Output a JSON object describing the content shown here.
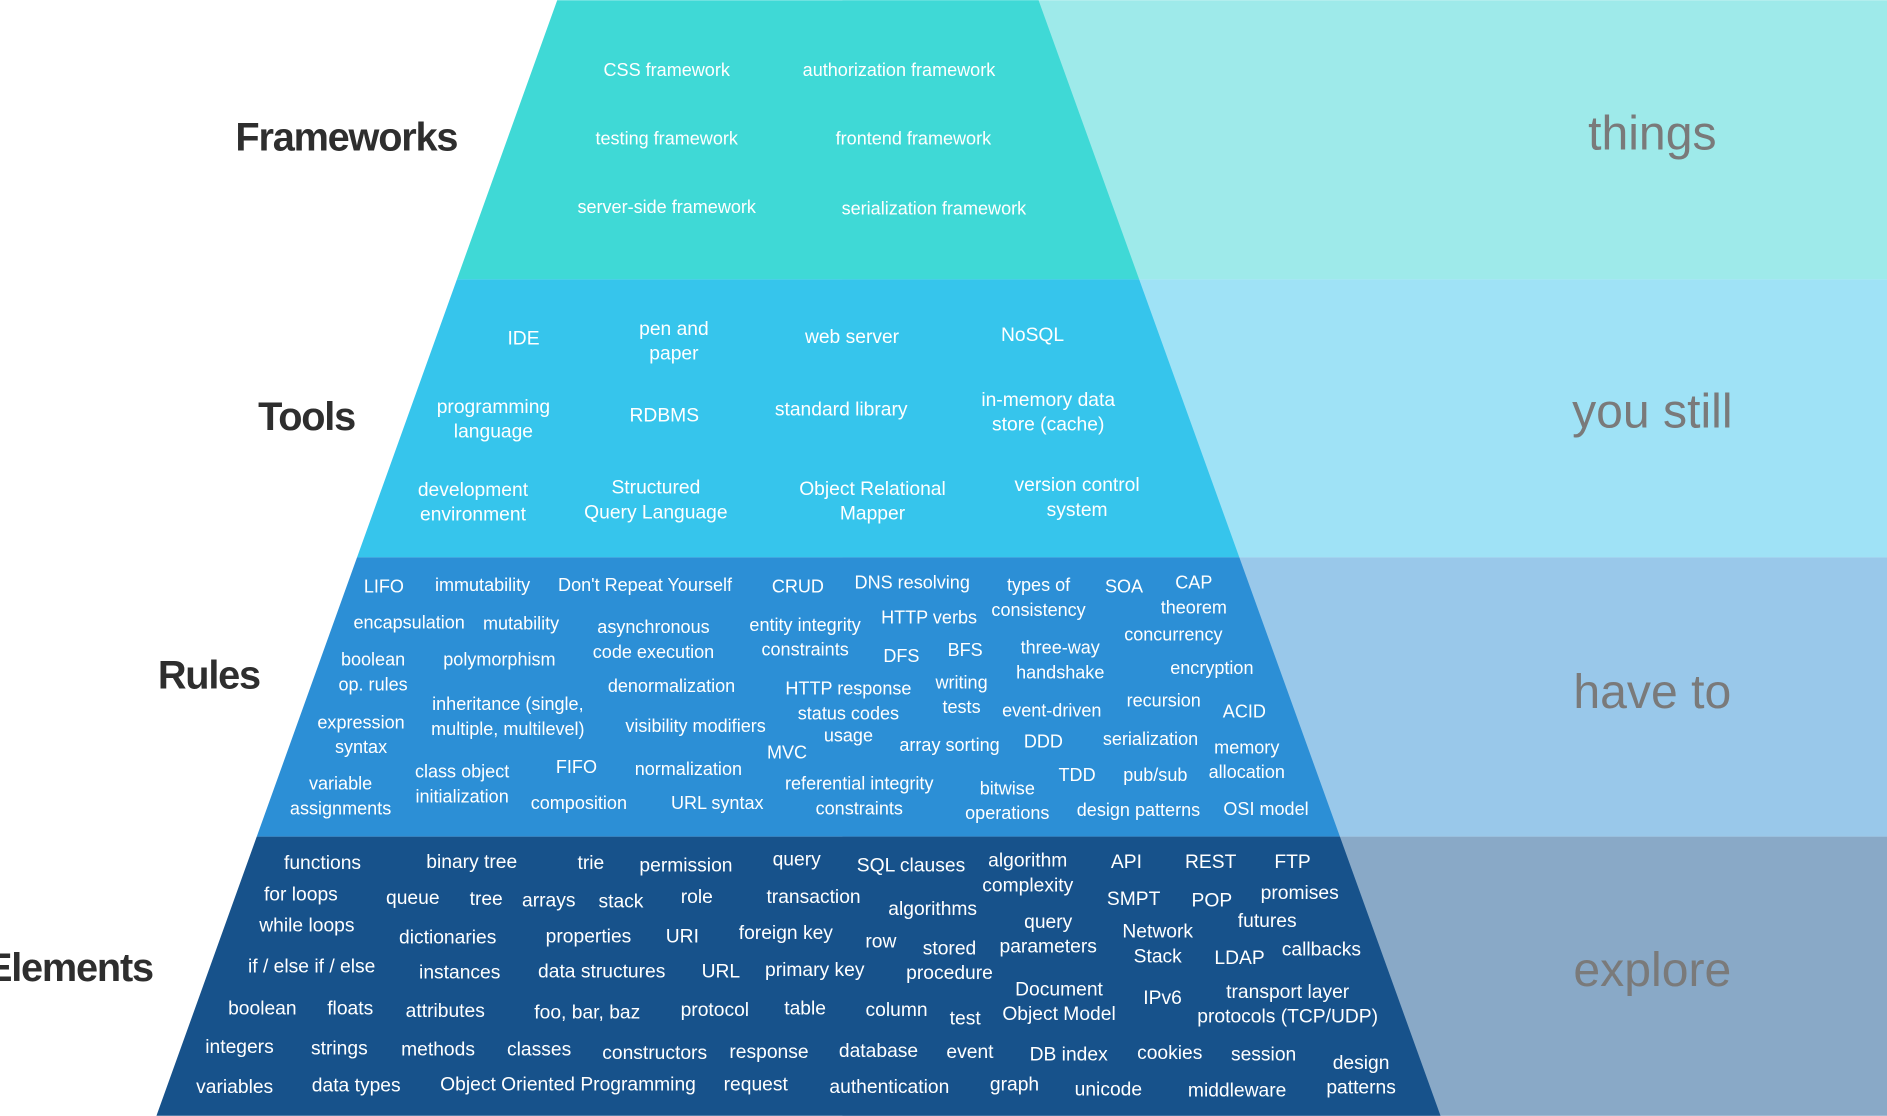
{
  "bands": [
    {
      "label": "Frameworks",
      "side_label": "things",
      "colors": {
        "pyramid": "#3fd9d6",
        "side": "#9eeaea"
      },
      "items": [
        "CSS framework",
        "authorization framework",
        "testing framework",
        "frontend framework",
        "server-side framework",
        "serialization framework"
      ]
    },
    {
      "label": "Tools",
      "side_label": "you still",
      "colors": {
        "pyramid": "#36c5ec",
        "side": "#9fe2f6"
      },
      "items": [
        "IDE",
        [
          "pen and",
          "paper"
        ],
        "web server",
        "NoSQL",
        [
          "programming",
          "language"
        ],
        "RDBMS",
        "standard library",
        [
          "in-memory data",
          "store (cache)"
        ],
        [
          "development",
          "environment"
        ],
        [
          "Structured",
          "Query Language"
        ],
        [
          "Object Relational",
          "Mapper"
        ],
        [
          "version control",
          "system"
        ]
      ]
    },
    {
      "label": "Rules",
      "side_label": "have to",
      "colors": {
        "pyramid": "#2c8fd6",
        "side": "#99c8ea"
      },
      "items": [
        "LIFO",
        "immutability",
        "Don't Repeat Yourself",
        "CRUD",
        "DNS resolving",
        [
          "types of",
          "consistency"
        ],
        "SOA",
        [
          "CAP",
          "theorem"
        ],
        "encapsulation",
        "mutability",
        [
          "asynchronous",
          "code execution"
        ],
        [
          "entity integrity",
          "constraints"
        ],
        "HTTP verbs",
        "concurrency",
        [
          "boolean",
          "op. rules"
        ],
        "polymorphism",
        "DFS",
        "BFS",
        [
          "three-way",
          "handshake"
        ],
        "encryption",
        "denormalization",
        [
          "HTTP response",
          "status  codes"
        ],
        [
          "writing",
          "tests"
        ],
        "recursion",
        [
          "inheritance (single,",
          "multiple, multilevel)"
        ],
        "event-driven",
        "ACID",
        [
          "expression",
          "syntax"
        ],
        "visibility modifiers",
        "usage",
        "array sorting",
        "DDD",
        "serialization",
        [
          "memory",
          "allocation"
        ],
        "MVC",
        [
          "class object",
          "initialization"
        ],
        "FIFO",
        "normalization",
        [
          "referential integrity",
          "constraints"
        ],
        "TDD",
        "pub/sub",
        [
          "variable",
          "assignments"
        ],
        [
          "bitwise",
          "operations"
        ],
        "composition",
        "URL syntax",
        "design patterns",
        "OSI model"
      ]
    },
    {
      "label": "Elements",
      "side_label": "explore",
      "colors": {
        "pyramid": "#17528b",
        "side": "#89a9c7"
      },
      "items": [
        "functions",
        "binary tree",
        "trie",
        "permission",
        "query",
        "SQL clauses",
        [
          "algorithm",
          "complexity"
        ],
        "API",
        "REST",
        "FTP",
        "for loops",
        "queue",
        "tree",
        "arrays",
        "stack",
        "role",
        "transaction",
        "algorithms",
        "SMPT",
        "POP",
        "promises",
        "while loops",
        "dictionaries",
        "properties",
        "URI",
        "foreign key",
        "row",
        [
          "query",
          "parameters"
        ],
        [
          "Network",
          "Stack"
        ],
        "futures",
        [
          "stored",
          "procedure"
        ],
        "LDAP",
        "callbacks",
        "if / else if / else",
        "instances",
        "data structures",
        "URL",
        "primary key",
        "boolean",
        "floats",
        "attributes",
        "foo, bar, baz",
        "protocol",
        "table",
        "column",
        "test",
        [
          "Document",
          "Object Model"
        ],
        "IPv6",
        [
          "transport layer",
          "protocols (TCP/UDP)"
        ],
        "integers",
        "strings",
        "methods",
        "classes",
        "constructors",
        "response",
        "database",
        "event",
        "DB index",
        "cookies",
        "session",
        [
          "design",
          "patterns"
        ],
        "variables",
        "data types",
        "Object Oriented Programming",
        "request",
        "authentication",
        "graph",
        "unicode",
        "middleware"
      ]
    }
  ]
}
